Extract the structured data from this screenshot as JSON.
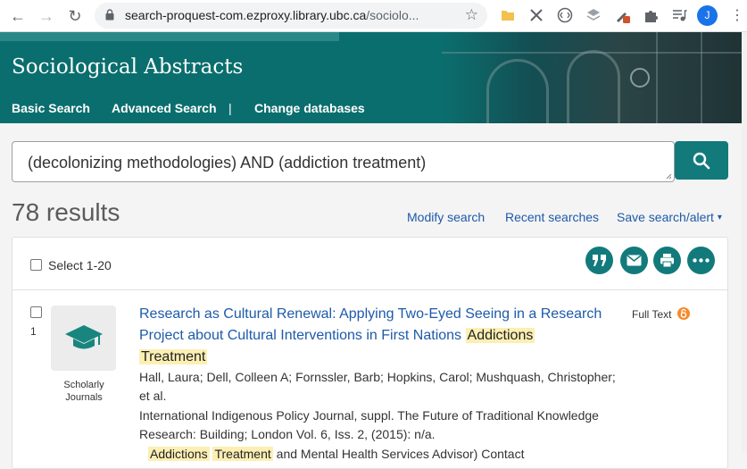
{
  "browser": {
    "url_host": "search-proquest-com.ezproxy.library.ubc.ca",
    "url_path": "/sociolo...",
    "profile_initial": "J"
  },
  "header": {
    "db_title": "Sociological Abstracts",
    "nav": [
      {
        "label": "Basic Search"
      },
      {
        "label": "Advanced Search"
      },
      {
        "label": "|"
      },
      {
        "label": "Change databases"
      }
    ]
  },
  "search": {
    "query": "(decolonizing methodologies) AND (addiction treatment)"
  },
  "results": {
    "count_text": "78 results",
    "links": {
      "modify": "Modify search",
      "recent": "Recent searches",
      "save": "Save search/alert",
      "save_caret": "▾"
    }
  },
  "toolbar": {
    "select_label": "Select 1-20",
    "icons": [
      "cite-icon",
      "email-icon",
      "print-icon",
      "more-icon"
    ]
  },
  "items": [
    {
      "number": "1",
      "type_line1": "Scholarly",
      "type_line2": "Journals",
      "title_line1": "Research as Cultural Renewal: Applying Two-Eyed Seeing in a Research",
      "title_line2": "Project about Cultural Interventions in First Nations",
      "title_hl1": "Addictions",
      "title_hl2": "Treatment",
      "authors_line1": "Hall, Laura; Dell, Colleen A; Fornssler, Barb; Hopkins, Carol; Mushquash, Christopher;",
      "authors_line2": "et al.",
      "source_line1": "International Indigenous Policy Journal, suppl. The Future of Traditional Knowledge",
      "source_line2": "Research: Building; London Vol. 6, Iss. 2,  (2015): n/a.",
      "fulltext_label": "Full Text",
      "snippet_hl1": "Addictions",
      "snippet_hl2": "Treatment",
      "snippet_rest": "and Mental Health Services Advisor) Contact"
    }
  ],
  "colors": {
    "teal": "#0b6e6e",
    "button": "#137a7c",
    "link": "#1d5aa9",
    "highlight": "#fcefb4"
  }
}
